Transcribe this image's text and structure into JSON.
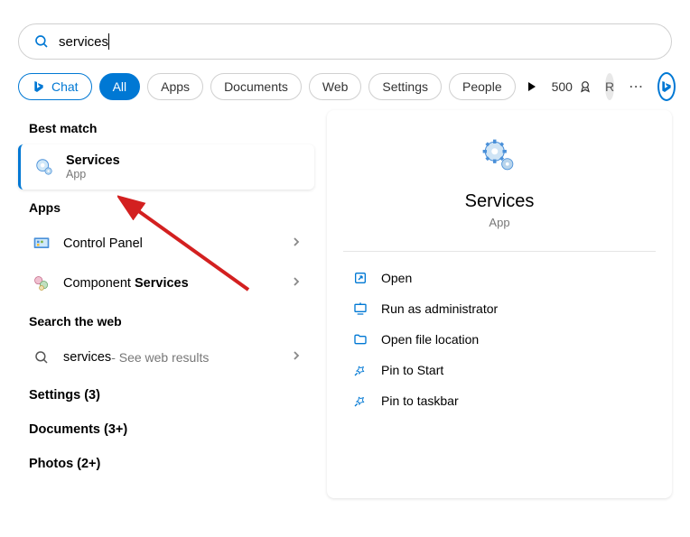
{
  "search": {
    "query": "services"
  },
  "tabs": {
    "chat": "Chat",
    "all": "All",
    "apps": "Apps",
    "documents": "Documents",
    "web": "Web",
    "settings": "Settings",
    "people": "People"
  },
  "rewards": {
    "points": "500"
  },
  "avatar": {
    "initial": "R"
  },
  "sections": {
    "best_match": "Best match",
    "apps": "Apps",
    "search_web": "Search the web"
  },
  "best_match": {
    "title": "Services",
    "subtitle": "App"
  },
  "apps_list": [
    {
      "label": "Control Panel",
      "bold_suffix": ""
    },
    {
      "label_prefix": "Component ",
      "label_bold": "Services"
    }
  ],
  "web_result": {
    "term": "services",
    "suffix": " - See web results"
  },
  "categories": {
    "settings": "Settings (3)",
    "documents": "Documents (3+)",
    "photos": "Photos (2+)"
  },
  "detail": {
    "title": "Services",
    "subtitle": "App",
    "actions": {
      "open": "Open",
      "run_admin": "Run as administrator",
      "open_location": "Open file location",
      "pin_start": "Pin to Start",
      "pin_taskbar": "Pin to taskbar"
    }
  }
}
